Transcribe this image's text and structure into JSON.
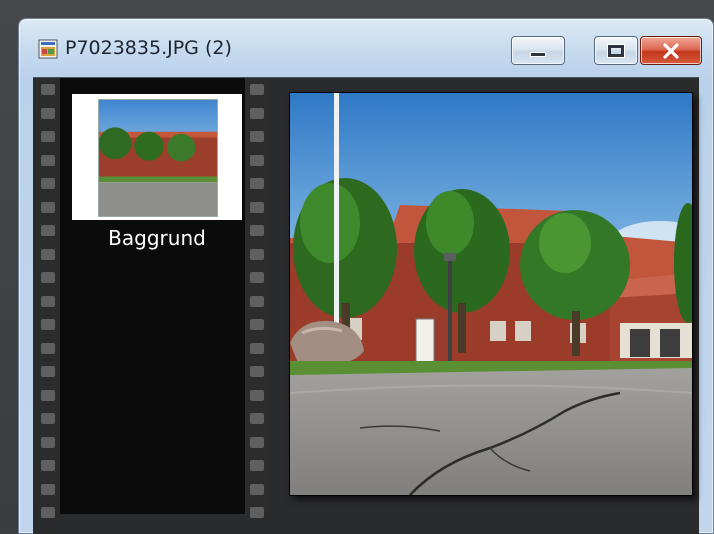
{
  "window": {
    "title": "P7023835.JPG (2)",
    "icon": "image-document-icon",
    "controls": {
      "minimize": "minimize-icon",
      "maximize": "maximize-icon",
      "close": "close-icon"
    }
  },
  "filmstrip": {
    "items": [
      {
        "label": "Baggrund",
        "selected": true
      }
    ]
  },
  "colors": {
    "accent": "#c3371c",
    "frame": "#c7dbef",
    "strip": "#0b0b0b"
  }
}
